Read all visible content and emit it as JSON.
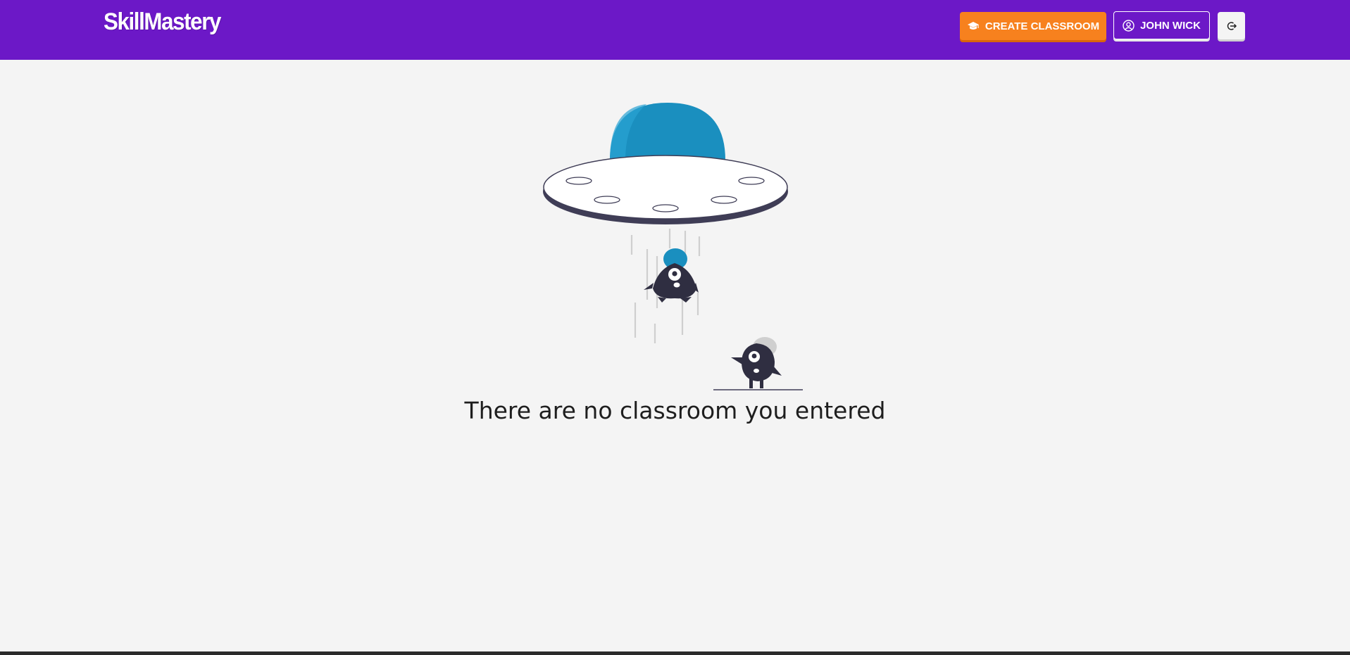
{
  "app": {
    "brand": "SkillMastery"
  },
  "header": {
    "create_classroom_label": "CREATE CLASSROOM",
    "user_name": "JOHN WICK",
    "icons": {
      "create": "graduation-cap-icon",
      "user": "user-circle-icon",
      "logout": "logout-icon"
    }
  },
  "main": {
    "empty_message": "There are no classroom you entered"
  },
  "colors": {
    "navbar": "#6c18c7",
    "accent": "#f7811e",
    "ufo_dome": "#1a8fbf",
    "dark": "#2f2e41"
  }
}
